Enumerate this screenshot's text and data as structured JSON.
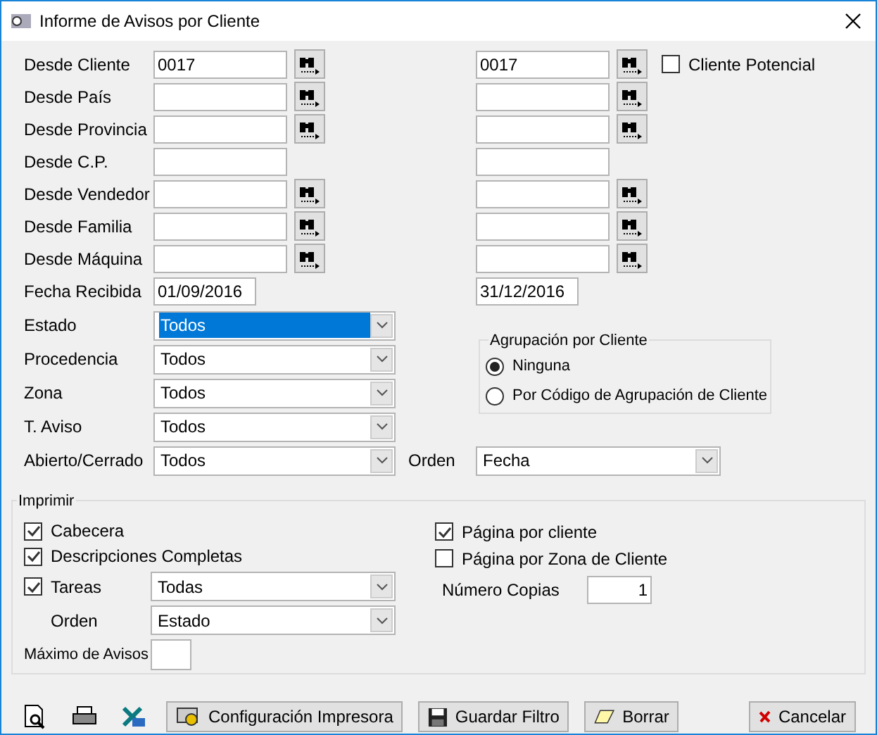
{
  "window": {
    "title": "Informe de Avisos por Cliente"
  },
  "range_fields": [
    {
      "label": "Desde Cliente",
      "from": "0017",
      "to": "0017",
      "search": true
    },
    {
      "label": "Desde País",
      "search": true
    },
    {
      "label": "Desde Provincia",
      "search": true
    },
    {
      "label": "Desde C.P.",
      "search": false
    },
    {
      "label": "Desde Vendedor",
      "search": true
    },
    {
      "label": "Desde Familia",
      "search": true
    },
    {
      "label": "Desde Máquina",
      "search": true
    }
  ],
  "cliente_potencial": {
    "label": "Cliente Potencial",
    "checked": false
  },
  "fecha_recibida": {
    "label": "Fecha Recibida",
    "from": "01/09/2016",
    "to": "31/12/2016"
  },
  "combos": [
    {
      "label": "Estado",
      "value": "Todos",
      "focused": true
    },
    {
      "label": "Procedencia",
      "value": "Todos",
      "focused": false
    },
    {
      "label": "Zona",
      "value": "Todos",
      "focused": false
    },
    {
      "label": "T. Aviso",
      "value": "Todos",
      "focused": false
    },
    {
      "label": "Abierto/Cerrado",
      "value": "Todos",
      "focused": false
    }
  ],
  "agrupacion": {
    "title": "Agrupación por Cliente",
    "options": [
      {
        "label": "Ninguna",
        "selected": true
      },
      {
        "label": "Por Código de Agrupación de Cliente",
        "selected": false
      }
    ]
  },
  "orden": {
    "label": "Orden",
    "value": "Fecha"
  },
  "imprimir": {
    "title": "Imprimir",
    "left": [
      {
        "label": "Cabecera",
        "checked": true
      },
      {
        "label": "Descripciones Completas",
        "checked": true
      },
      {
        "label": "Tareas",
        "checked": true
      }
    ],
    "tareas_value": "Todas",
    "orden_label": "Orden",
    "orden_value": "Estado",
    "maximo_label": "Máximo de Avisos",
    "right": [
      {
        "label": "Página por cliente",
        "checked": true
      },
      {
        "label": "Página por Zona de Cliente",
        "checked": false
      }
    ],
    "copias_label": "Número Copias",
    "copias_value": "1"
  },
  "buttons": [
    {
      "kind": "config",
      "label": "Configuración Impresora"
    },
    {
      "kind": "save",
      "label": "Guardar Filtro"
    },
    {
      "kind": "erase",
      "label": "Borrar"
    },
    {
      "kind": "cancel",
      "label": "Cancelar"
    }
  ]
}
